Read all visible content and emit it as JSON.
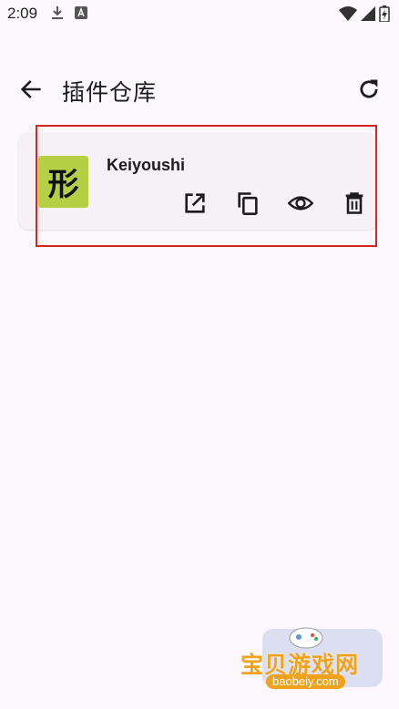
{
  "status_bar": {
    "time": "2:09",
    "icons": [
      "download-icon",
      "a-badge-icon",
      "wifi-icon",
      "signal-icon",
      "battery-charging-icon"
    ]
  },
  "app_bar": {
    "title": "插件仓库",
    "back_icon": "arrow-back-icon",
    "refresh_icon": "refresh-icon"
  },
  "plugins": [
    {
      "name": "Keiyoushi",
      "thumbnail_glyph": "形",
      "thumbnail_color": "#b7cf44",
      "actions": [
        "open-external-icon",
        "copy-icon",
        "view-icon",
        "delete-icon"
      ]
    }
  ],
  "watermark": {
    "title": "宝贝游戏网",
    "url": "baobeiy.com"
  },
  "colors": {
    "background": "#fdf8fd",
    "card": "#f5f1f6",
    "highlight": "#d0271f",
    "watermark_accent": "#f0a21a"
  }
}
